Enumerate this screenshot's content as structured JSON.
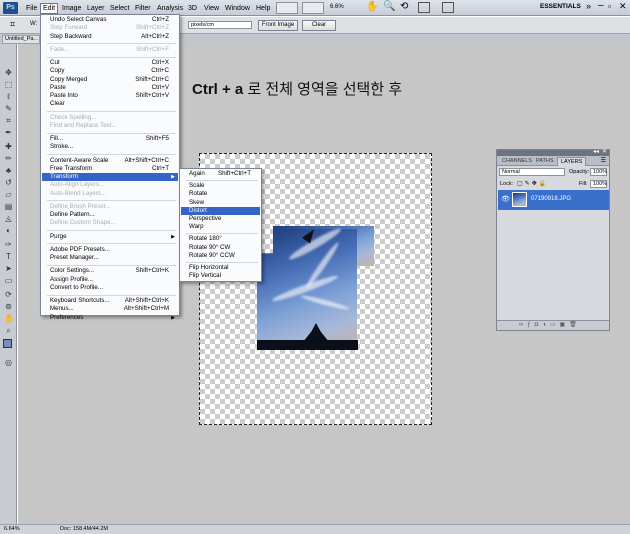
{
  "menubar": {
    "logo": "Ps",
    "items": [
      "File",
      "Edit",
      "Image",
      "Layer",
      "Select",
      "Filter",
      "Analysis",
      "3D",
      "View",
      "Window",
      "Help"
    ],
    "zoom": "6.6%",
    "workspace": "ESSENTIALS"
  },
  "options": {
    "w_label": "W:",
    "units": "pixels/cm",
    "front_image": "Front Image",
    "clear": "Clear"
  },
  "document": {
    "tab": "Untitled_Pa..."
  },
  "headline": {
    "bold": "Ctrl + a",
    "rest": " 로 전체 영역을 선택한 후"
  },
  "edit_menu": {
    "items": [
      {
        "label": "Undo Select Canvas",
        "shortcut": "Ctrl+Z",
        "disabled": false
      },
      {
        "label": "Step Forward",
        "shortcut": "Shift+Ctrl+Z",
        "disabled": true
      },
      {
        "label": "Step Backward",
        "shortcut": "Alt+Ctrl+Z",
        "disabled": false
      },
      {
        "sep": true
      },
      {
        "label": "Fade...",
        "shortcut": "Shift+Ctrl+F",
        "disabled": true
      },
      {
        "sep": true
      },
      {
        "label": "Cut",
        "shortcut": "Ctrl+X",
        "disabled": false
      },
      {
        "label": "Copy",
        "shortcut": "Ctrl+C",
        "disabled": false
      },
      {
        "label": "Copy Merged",
        "shortcut": "Shift+Ctrl+C",
        "disabled": false
      },
      {
        "label": "Paste",
        "shortcut": "Ctrl+V",
        "disabled": false
      },
      {
        "label": "Paste Into",
        "shortcut": "Shift+Ctrl+V",
        "disabled": false
      },
      {
        "label": "Clear",
        "shortcut": "",
        "disabled": false
      },
      {
        "sep": true
      },
      {
        "label": "Check Spelling...",
        "shortcut": "",
        "disabled": true
      },
      {
        "label": "Find and Replace Text...",
        "shortcut": "",
        "disabled": true
      },
      {
        "sep": true
      },
      {
        "label": "Fill...",
        "shortcut": "Shift+F5",
        "disabled": false
      },
      {
        "label": "Stroke...",
        "shortcut": "",
        "disabled": false
      },
      {
        "sep": true
      },
      {
        "label": "Content-Aware Scale",
        "shortcut": "Alt+Shift+Ctrl+C",
        "disabled": false
      },
      {
        "label": "Free Transform",
        "shortcut": "Ctrl+T",
        "disabled": false
      },
      {
        "label": "Transform",
        "shortcut": "",
        "disabled": false,
        "highlight": true,
        "submenu": true
      },
      {
        "label": "Auto-Align Layers...",
        "shortcut": "",
        "disabled": true
      },
      {
        "label": "Auto-Blend Layers...",
        "shortcut": "",
        "disabled": true
      },
      {
        "sep": true
      },
      {
        "label": "Define Brush Preset...",
        "shortcut": "",
        "disabled": true
      },
      {
        "label": "Define Pattern...",
        "shortcut": "",
        "disabled": false
      },
      {
        "label": "Define Custom Shape...",
        "shortcut": "",
        "disabled": true
      },
      {
        "sep": true
      },
      {
        "label": "Purge",
        "shortcut": "",
        "disabled": false,
        "submenu": true
      },
      {
        "sep": true
      },
      {
        "label": "Adobe PDF Presets...",
        "shortcut": "",
        "disabled": false
      },
      {
        "label": "Preset Manager...",
        "shortcut": "",
        "disabled": false
      },
      {
        "sep": true
      },
      {
        "label": "Color Settings...",
        "shortcut": "Shift+Ctrl+K",
        "disabled": false
      },
      {
        "label": "Assign Profile...",
        "shortcut": "",
        "disabled": false
      },
      {
        "label": "Convert to Profile...",
        "shortcut": "",
        "disabled": false
      },
      {
        "sep": true
      },
      {
        "label": "Keyboard Shortcuts...",
        "shortcut": "Alt+Shift+Ctrl+K",
        "disabled": false
      },
      {
        "label": "Menus...",
        "shortcut": "Alt+Shift+Ctrl+M",
        "disabled": false
      },
      {
        "label": "Preferences",
        "shortcut": "",
        "disabled": false,
        "submenu": true
      }
    ]
  },
  "transform_menu": {
    "items": [
      {
        "label": "Again",
        "shortcut": "Shift+Ctrl+T"
      },
      {
        "sep": true
      },
      {
        "label": "Scale"
      },
      {
        "label": "Rotate"
      },
      {
        "label": "Skew"
      },
      {
        "label": "Distort",
        "highlight": true
      },
      {
        "label": "Perspective"
      },
      {
        "label": "Warp"
      },
      {
        "sep": true
      },
      {
        "label": "Rotate 180°"
      },
      {
        "label": "Rotate 90° CW"
      },
      {
        "label": "Rotate 90° CCW"
      },
      {
        "sep": true
      },
      {
        "label": "Flip Horizontal"
      },
      {
        "label": "Flip Vertical"
      }
    ]
  },
  "layers_panel": {
    "tabs": [
      "CHANNELS",
      "PATHS",
      "LAYERS"
    ],
    "blend_mode": "Normal",
    "opacity_label": "Opacity:",
    "opacity": "100%",
    "lock_label": "Lock:",
    "fill_label": "Fill:",
    "fill": "100%",
    "layer_name": "07190918.JPG"
  },
  "status": {
    "zoom": "6.64%",
    "doc": "Doc: 158.4M/44.2M"
  },
  "colors": {
    "highlight": "#3563c6",
    "layer_selected": "#3a6fcc"
  }
}
